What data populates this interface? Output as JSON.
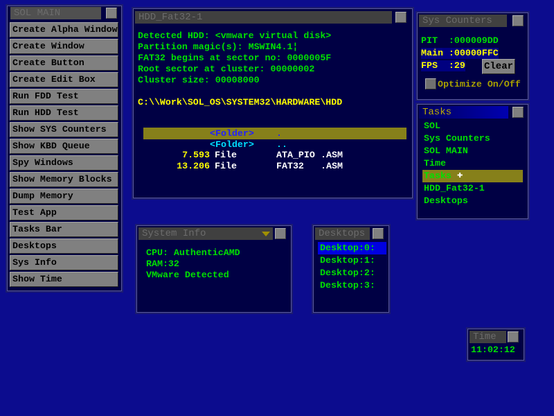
{
  "sol_main": {
    "title": "SOL MAIN",
    "buttons": [
      "Create Alpha Window",
      "Create Window",
      "Create Button",
      "Create Edit Box",
      "Run FDD Test",
      "Run HDD Test",
      "Show SYS Counters",
      "Show KBD Queue",
      "Spy Windows",
      "Show Memory Blocks",
      "Dump Memory",
      "Test App",
      "Tasks Bar",
      "Desktops",
      "Sys Info",
      "Show Time"
    ]
  },
  "hdd": {
    "title": "HDD_Fat32-1",
    "lines": [
      "Detected HDD: <vmware virtual disk>",
      "Partition magic(s): MSWIN4.1¦",
      "FAT32 begins at sector no: 0000005F",
      "Root sector at cluster: 00000002",
      "Cluster size: 00008000"
    ],
    "path": "C:\\\\Work\\SOL_OS\\SYSTEM32\\HARDWARE\\HDD",
    "files": [
      {
        "size": "",
        "type": "<Folder>",
        "name": ".",
        "ext": ""
      },
      {
        "size": "",
        "type": "<Folder>",
        "name": "..",
        "ext": ""
      },
      {
        "size": "7.593",
        "type": "File",
        "name": "ATA_PIO",
        "ext": ".ASM"
      },
      {
        "size": "13.206",
        "type": "File",
        "name": "FAT32",
        "ext": ".ASM"
      }
    ]
  },
  "sys_counters": {
    "title": "Sys Counters",
    "pit_label": "PIT",
    "pit": ":000009DD",
    "main_label": "Main",
    "main": ":00000FFC",
    "fps_label": "FPS",
    "fps": ":29",
    "clear": "Clear",
    "optimize": "Optimize On/Off"
  },
  "tasks": {
    "title": "Tasks",
    "items": [
      "SOL",
      "Sys Counters",
      "SOL MAIN",
      "Time",
      "Tasks",
      "HDD_Fat32-1",
      "Desktops"
    ],
    "selected": 4
  },
  "system_info": {
    "title": "System Info",
    "lines": [
      "CPU: AuthenticAMD",
      "RAM:32",
      "VMware Detected"
    ]
  },
  "desktops": {
    "title": "Desktops",
    "items": [
      "Desktop:0:",
      "Desktop:1:",
      "Desktop:2:",
      "Desktop:3:"
    ],
    "selected": 0
  },
  "time": {
    "title": "Time",
    "value": "11:02:12"
  },
  "colors": {
    "desktop": "#0c0c8e",
    "window": "#000044",
    "text_green": "#00e000",
    "text_yellow": "#ffff00",
    "highlight": "#86801a"
  }
}
